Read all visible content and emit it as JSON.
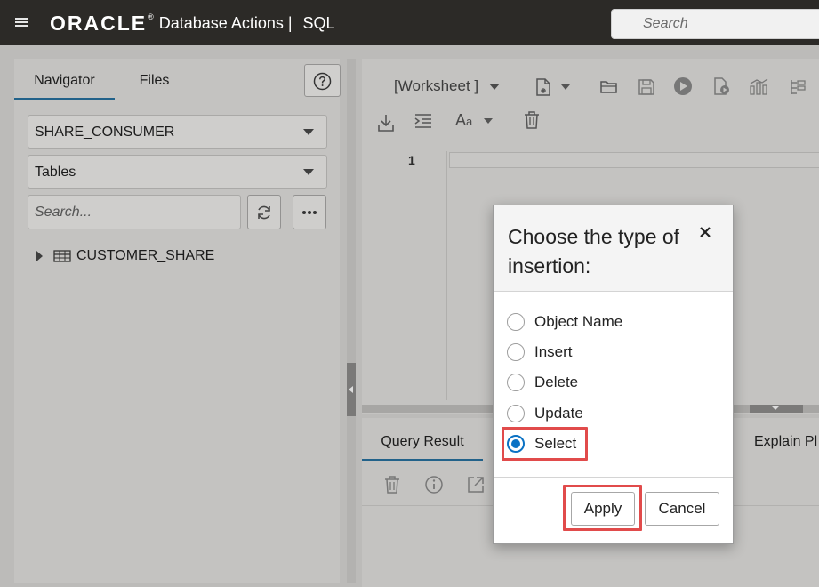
{
  "header": {
    "logo_text": "ORACLE",
    "reg_mark": "®",
    "product_title": "Database Actions |",
    "module_title": "SQL",
    "search_placeholder": "Search"
  },
  "navigator": {
    "tabs": [
      "Navigator",
      "Files"
    ],
    "schema": "SHARE_CONSUMER",
    "object_type": "Tables",
    "search_placeholder": "Search...",
    "tree_items": [
      "CUSTOMER_SHARE"
    ]
  },
  "worksheet": {
    "selector": "[Worksheet ]",
    "font_label": "A",
    "font_label_small": "a",
    "line_numbers": [
      "1"
    ]
  },
  "results": {
    "tabs": [
      "Query Result",
      "Explain Pl"
    ]
  },
  "dialog": {
    "title": "Choose the type of insertion:",
    "close_glyph": "×",
    "options": [
      "Object Name",
      "Insert",
      "Delete",
      "Update",
      "Select"
    ],
    "selected": "Select",
    "apply_label": "Apply",
    "cancel_label": "Cancel"
  }
}
